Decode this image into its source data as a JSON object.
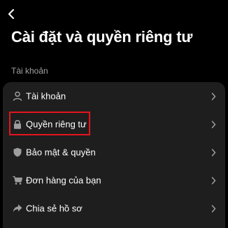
{
  "header": {
    "back_icon": "chevron-left-icon",
    "title": "Cài đặt và quyền riêng tư"
  },
  "section": {
    "label": "Tài khoản"
  },
  "menu": {
    "items": [
      {
        "label": "Tài khoản",
        "icon": "person-icon"
      },
      {
        "label": "Quyền riêng tư",
        "icon": "lock-icon",
        "highlighted": true
      },
      {
        "label": "Bảo mật & quyền",
        "icon": "shield-icon"
      },
      {
        "label": "Đơn hàng của bạn",
        "icon": "cart-icon"
      },
      {
        "label": "Chia sẻ hồ sơ",
        "icon": "share-icon"
      }
    ]
  },
  "colors": {
    "background": "#000000",
    "card": "#1e1e1e",
    "text": "#ffffff",
    "muted": "#a0a0a0",
    "icon": "#9e9e9e",
    "highlight": "#e3141e"
  }
}
